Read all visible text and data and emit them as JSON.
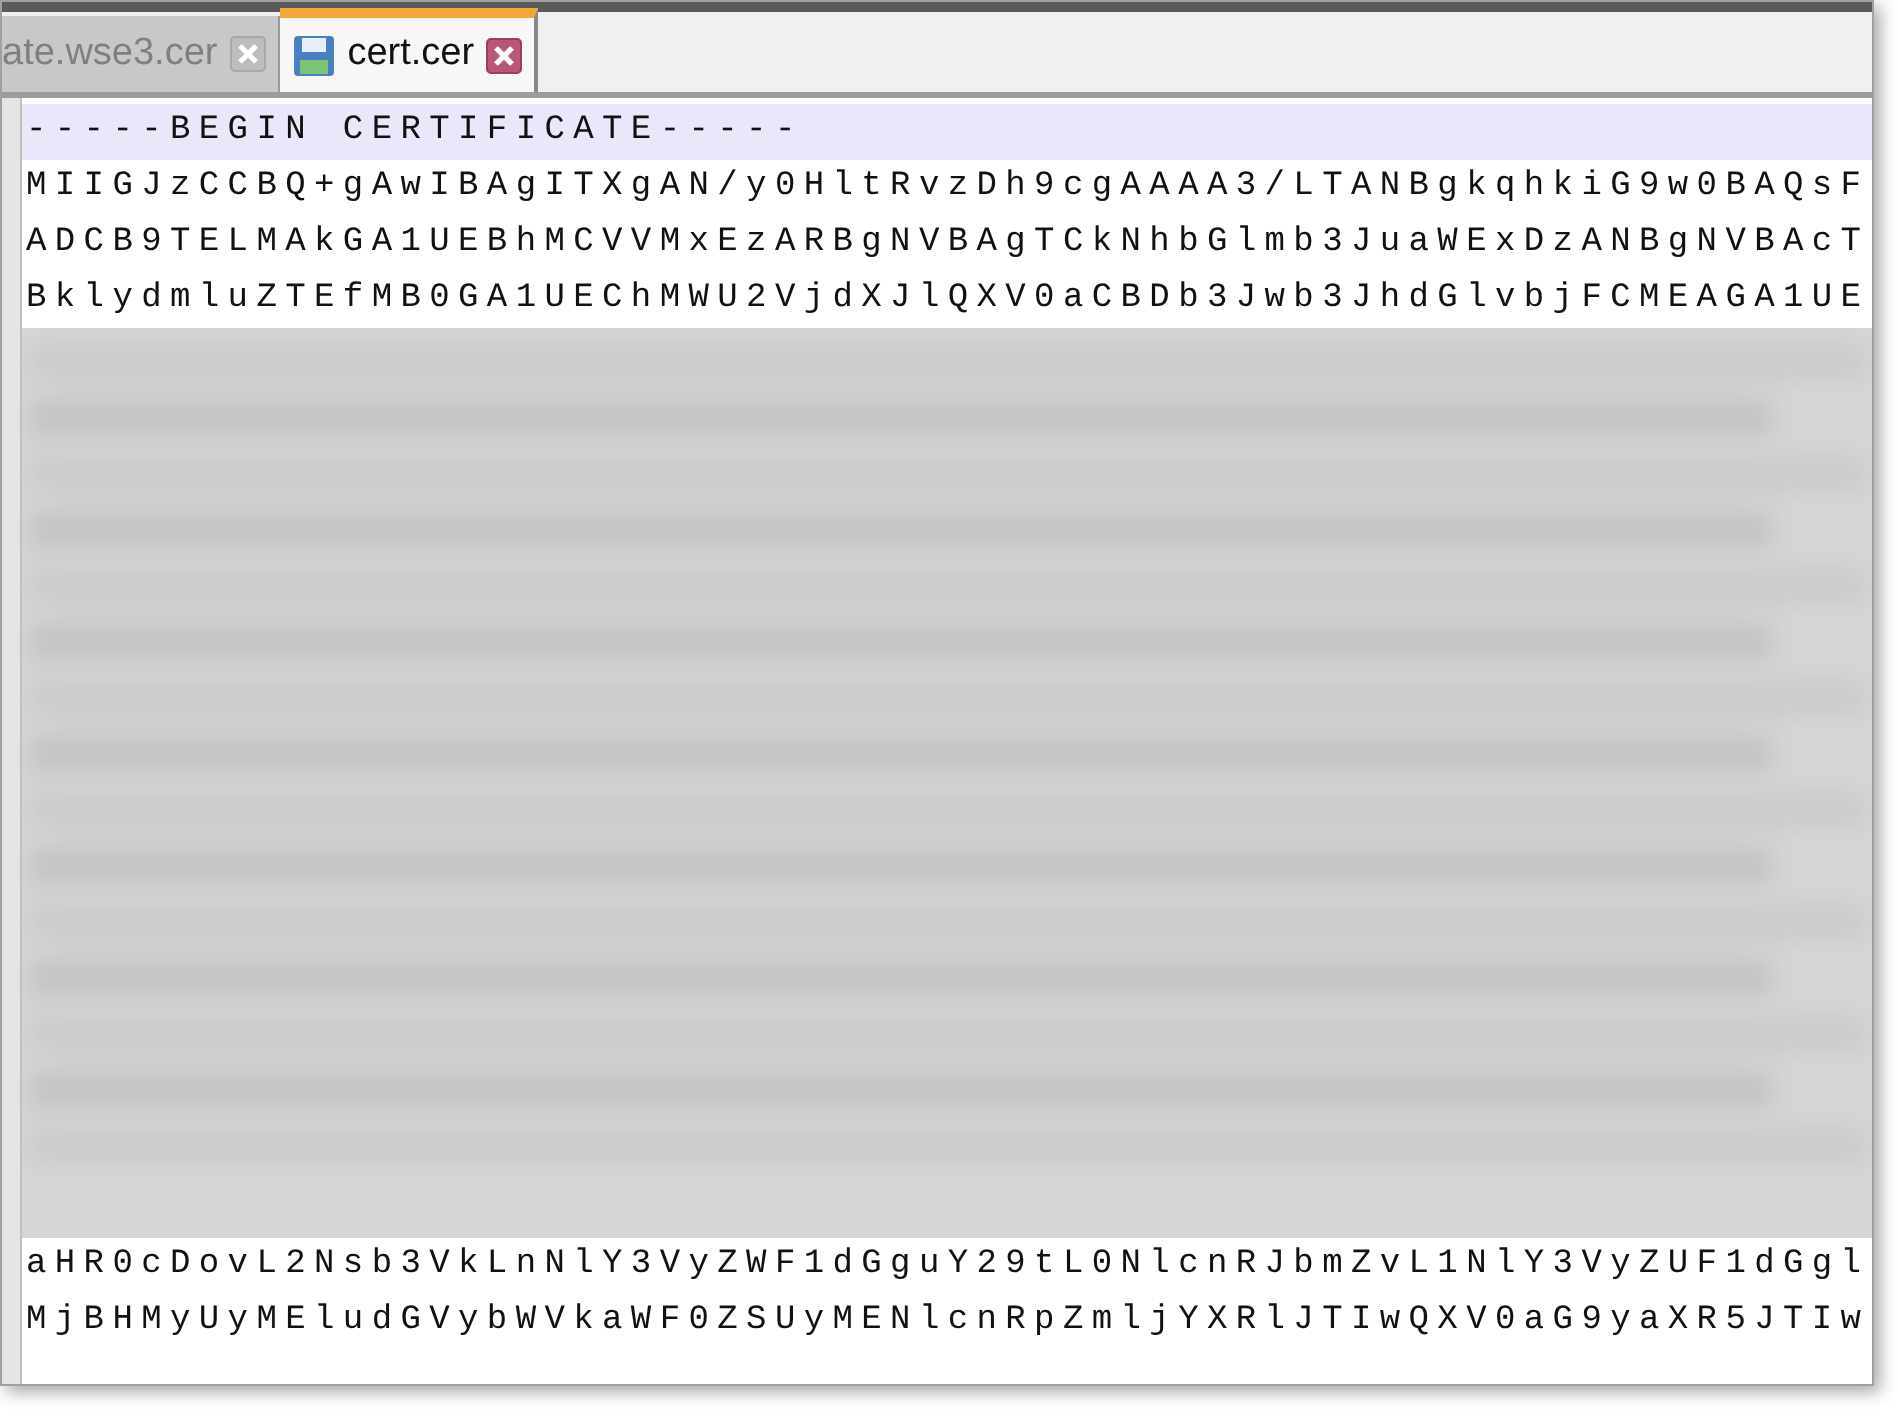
{
  "tabs": [
    {
      "label": "ate.wse3.cer",
      "selected": false
    },
    {
      "label": "cert.cer",
      "selected": true
    }
  ],
  "editor": {
    "lines_top": [
      {
        "text": "-----BEGIN CERTIFICATE-----",
        "current": true
      },
      {
        "text": "MIIGJzCCBQ+gAwIBAgITXgAN/y0HltRvzDh9cgAAAA3/LTANBgkqhkiG9w0BAQsF",
        "current": false
      },
      {
        "text": "ADCB9TELMAkGA1UEBhMCVVMxEzARBgNVBAgTCkNhbGlmb3JuaWExDzANBgNVBAcT",
        "current": false
      },
      {
        "text": "BklydmluZTEfMB0GA1UEChMWU2VjdXJlQXV0aCBDb3Jwb3JhdGlvbjFCMEAGA1UE",
        "current": false
      }
    ],
    "lines_bottom": [
      {
        "text": "aHR0cDovL2Nsb3VkLnNlY3VyZWF1dGguY29tL0NlcnRJbmZvL1NlY3VyZUF1dGgl",
        "current": false
      },
      {
        "text": "MjBHMyUyMEludGVybWVkaWF0ZSUyMENlcnRpZmljYXRlJTIwQXV0aG9yaXR5JTIw",
        "current": false
      }
    ]
  }
}
